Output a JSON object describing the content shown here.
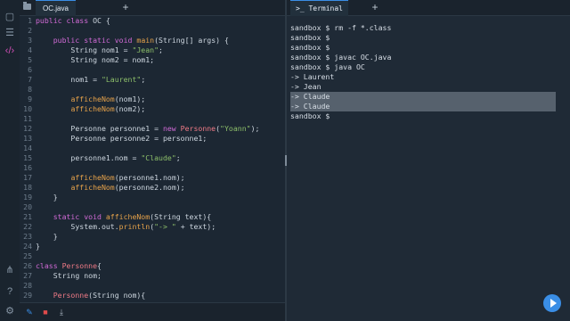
{
  "editor": {
    "tab_label": "OC.java",
    "plus": "+",
    "lines": [
      {
        "n": "1",
        "t": [
          [
            "kw",
            "public class "
          ],
          [
            "plain",
            "OC {"
          ]
        ]
      },
      {
        "n": "2",
        "t": []
      },
      {
        "n": "3",
        "t": [
          [
            "plain",
            "    "
          ],
          [
            "kw",
            "public static void "
          ],
          [
            "fn",
            "main"
          ],
          [
            "plain",
            "(String[] args) {"
          ]
        ]
      },
      {
        "n": "4",
        "t": [
          [
            "plain",
            "        String nom1 = "
          ],
          [
            "str",
            "\"Jean\""
          ],
          [
            "plain",
            ";"
          ]
        ]
      },
      {
        "n": "5",
        "t": [
          [
            "plain",
            "        String nom2 = nom1;"
          ]
        ]
      },
      {
        "n": "6",
        "t": []
      },
      {
        "n": "7",
        "t": [
          [
            "plain",
            "        nom1 = "
          ],
          [
            "str",
            "\"Laurent\""
          ],
          [
            "plain",
            ";"
          ]
        ]
      },
      {
        "n": "8",
        "t": []
      },
      {
        "n": "9",
        "t": [
          [
            "plain",
            "        "
          ],
          [
            "fn",
            "afficheNom"
          ],
          [
            "plain",
            "(nom1);"
          ]
        ]
      },
      {
        "n": "10",
        "t": [
          [
            "plain",
            "        "
          ],
          [
            "fn",
            "afficheNom"
          ],
          [
            "plain",
            "(nom2);"
          ]
        ]
      },
      {
        "n": "11",
        "t": []
      },
      {
        "n": "12",
        "t": [
          [
            "plain",
            "        Personne personne1 = "
          ],
          [
            "kw",
            "new "
          ],
          [
            "cls",
            "Personne"
          ],
          [
            "plain",
            "("
          ],
          [
            "str",
            "\"Yoann\""
          ],
          [
            "plain",
            ");"
          ]
        ]
      },
      {
        "n": "13",
        "t": [
          [
            "plain",
            "        Personne personne2 = personne1;"
          ]
        ]
      },
      {
        "n": "14",
        "t": []
      },
      {
        "n": "15",
        "t": [
          [
            "plain",
            "        personne1.nom = "
          ],
          [
            "str",
            "\"Claude\""
          ],
          [
            "plain",
            ";"
          ]
        ]
      },
      {
        "n": "16",
        "t": []
      },
      {
        "n": "17",
        "t": [
          [
            "plain",
            "        "
          ],
          [
            "fn",
            "afficheNom"
          ],
          [
            "plain",
            "(personne1.nom);"
          ]
        ]
      },
      {
        "n": "18",
        "t": [
          [
            "plain",
            "        "
          ],
          [
            "fn",
            "afficheNom"
          ],
          [
            "plain",
            "(personne2.nom);"
          ]
        ]
      },
      {
        "n": "19",
        "t": [
          [
            "plain",
            "    }"
          ]
        ]
      },
      {
        "n": "20",
        "t": []
      },
      {
        "n": "21",
        "t": [
          [
            "plain",
            "    "
          ],
          [
            "kw",
            "static void "
          ],
          [
            "fn",
            "afficheNom"
          ],
          [
            "plain",
            "(String text){"
          ]
        ]
      },
      {
        "n": "22",
        "t": [
          [
            "plain",
            "        System.out."
          ],
          [
            "fn",
            "println"
          ],
          [
            "plain",
            "("
          ],
          [
            "str",
            "\"-> \""
          ],
          [
            "plain",
            " + text);"
          ]
        ]
      },
      {
        "n": "23",
        "t": [
          [
            "plain",
            "    }"
          ]
        ]
      },
      {
        "n": "24",
        "t": [
          [
            "plain",
            "}"
          ]
        ]
      },
      {
        "n": "25",
        "t": []
      },
      {
        "n": "26",
        "t": [
          [
            "kw",
            "class "
          ],
          [
            "cls",
            "Personne"
          ],
          [
            "plain",
            "{"
          ]
        ]
      },
      {
        "n": "27",
        "t": [
          [
            "plain",
            "    String nom;"
          ]
        ]
      },
      {
        "n": "28",
        "t": []
      },
      {
        "n": "29",
        "t": [
          [
            "plain",
            "    "
          ],
          [
            "cls",
            "Personne"
          ],
          [
            "plain",
            "(String nom){"
          ]
        ]
      }
    ]
  },
  "terminal": {
    "tab_label": "Terminal",
    "plus": "+",
    "lines": [
      {
        "text": "sandbox $ rm -f *.class",
        "highlight": false
      },
      {
        "text": "sandbox $",
        "highlight": false
      },
      {
        "text": "sandbox $",
        "highlight": false
      },
      {
        "text": "sandbox $ javac OC.java",
        "highlight": false
      },
      {
        "text": "sandbox $ java OC",
        "highlight": false
      },
      {
        "text": "-> Laurent",
        "highlight": false
      },
      {
        "text": "-> Jean",
        "highlight": false
      },
      {
        "text": "-> Claude",
        "highlight": true
      },
      {
        "text": "-> Claude",
        "highlight": true
      },
      {
        "text": "sandbox $",
        "highlight": false
      }
    ]
  },
  "icons": {
    "activity": [
      "files-icon",
      "list-icon",
      "code-icon",
      "share-icon",
      "help-icon",
      "settings-icon"
    ],
    "footer": [
      "edit-icon",
      "delete-icon",
      "download-icon"
    ],
    "run": "play-icon"
  },
  "colors": {
    "accent": "#3a8ee6",
    "keyword": "#d16ad6",
    "function": "#e6a24a",
    "string": "#8dbf6a",
    "class": "#ef7a86"
  }
}
